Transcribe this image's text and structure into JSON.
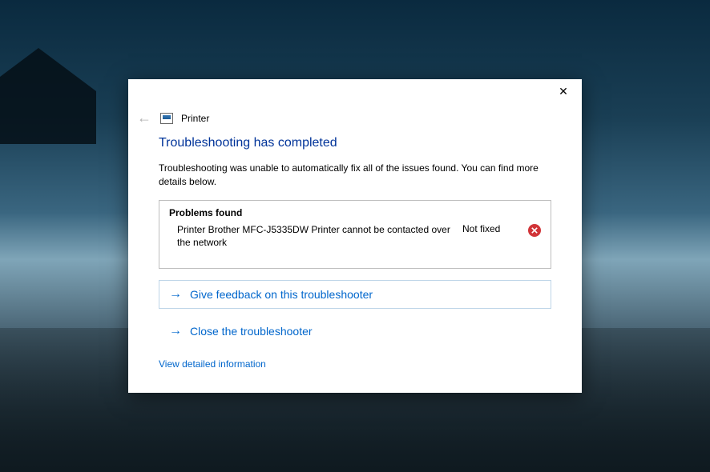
{
  "header": {
    "title": "Printer"
  },
  "main": {
    "heading": "Troubleshooting has completed",
    "description": "Troubleshooting was unable to automatically fix all of the issues found. You can find more details below."
  },
  "problems": {
    "heading": "Problems found",
    "items": [
      {
        "text": "Printer Brother MFC-J5335DW Printer cannot be contacted over the network",
        "status": "Not fixed",
        "icon": "error"
      }
    ]
  },
  "actions": {
    "feedback": "Give feedback on this troubleshooter",
    "close": "Close the troubleshooter"
  },
  "links": {
    "details": "View detailed information"
  }
}
